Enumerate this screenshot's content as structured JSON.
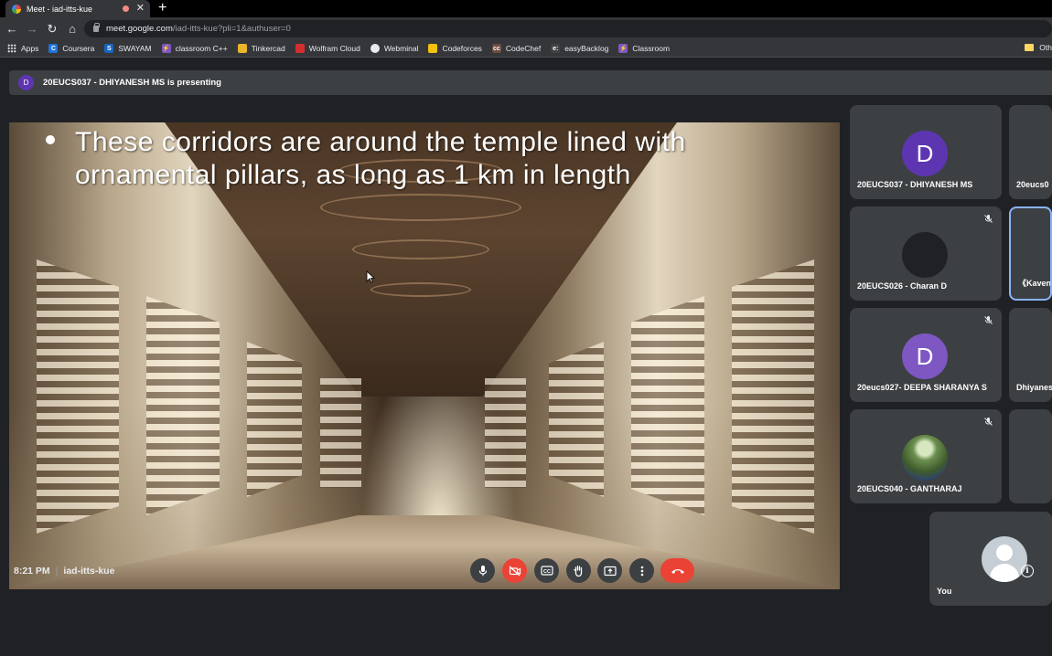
{
  "browser": {
    "tab": {
      "title": "Meet - iad-itts-kue",
      "close": "✕"
    },
    "new_tab": "+",
    "address": {
      "host": "meet.google.com",
      "path": "/iad-itts-kue?pli=1&authuser=0"
    },
    "nav": {
      "back": "←",
      "forward": "→",
      "reload": "↻",
      "home": "⌂"
    },
    "bookmarks": [
      {
        "label": "Apps",
        "icon": "apps-grid-icon",
        "glyph": "",
        "color": "#e8eaed"
      },
      {
        "label": "Coursera",
        "icon": "coursera-icon",
        "glyph": "C",
        "color": "#1f74d9"
      },
      {
        "label": "SWAYAM",
        "icon": "swayam-icon",
        "glyph": "S",
        "color": "#1565c0"
      },
      {
        "label": "classroom C++",
        "icon": "bolt-icon",
        "glyph": "⚡",
        "color": "#7e57c2"
      },
      {
        "label": "Tinkercad",
        "icon": "tinkercad-icon",
        "glyph": "",
        "color": "#e8b52b"
      },
      {
        "label": "Wolfram Cloud",
        "icon": "wolfram-icon",
        "glyph": "",
        "color": "#d32f2f"
      },
      {
        "label": "Webminal",
        "icon": "globe-icon",
        "glyph": "",
        "color": "#e8eaed"
      },
      {
        "label": "Codeforces",
        "icon": "codeforces-icon",
        "glyph": "",
        "color": "#f4c20d"
      },
      {
        "label": "CodeChef",
        "icon": "codechef-icon",
        "glyph": "cc",
        "color": "#6d4c41"
      },
      {
        "label": "easyBacklog",
        "icon": "easybacklog-icon",
        "glyph": "e:",
        "color": "#424242"
      },
      {
        "label": "Classroom",
        "icon": "bolt-icon",
        "glyph": "⚡",
        "color": "#7e57c2"
      }
    ],
    "other_bookmarks": "Oth"
  },
  "meet": {
    "presenting": {
      "avatar_letter": "D",
      "text": "20EUCS037 - DHIYANESH MS is presenting"
    },
    "slide": {
      "text": "These corridors are around the temple lined with ornamental pillars, as long as 1 km in length"
    },
    "participants": [
      {
        "name": "20EUCS037 - DHIYANESH MS",
        "letter": "D",
        "avatar_color": "#5e35b1",
        "muted": false
      },
      {
        "name": "20eucs0",
        "letter": "",
        "avatar_color": "",
        "muted": false
      },
      {
        "name": "20EUCS026 - Charan D",
        "letter": "",
        "avatar_color": "#202124",
        "muted": true
      },
      {
        "name": "《Kaven",
        "letter": "",
        "avatar_color": "",
        "muted": false
      },
      {
        "name": "20eucs027- DEEPA SHARANYA S",
        "letter": "D",
        "avatar_color": "#7e57c2",
        "muted": true
      },
      {
        "name": "Dhiyanes",
        "letter": "",
        "avatar_color": "",
        "muted": false
      },
      {
        "name": "20EUCS040 - GANTHARAJ",
        "letter": "",
        "avatar_color": "photo",
        "muted": true
      },
      {
        "name": "",
        "letter": "",
        "avatar_color": "",
        "muted": false
      }
    ],
    "self_tile": {
      "name": "You"
    },
    "footer": {
      "time": "8:21 PM",
      "meeting_code": "iad-itts-kue"
    },
    "controls": [
      {
        "name": "microphone-button",
        "icon": "microphone-icon"
      },
      {
        "name": "camera-off-button",
        "icon": "camera-off-icon"
      },
      {
        "name": "captions-button",
        "icon": "captions-icon"
      },
      {
        "name": "raise-hand-button",
        "icon": "hand-icon"
      },
      {
        "name": "present-screen-button",
        "icon": "present-screen-icon"
      },
      {
        "name": "more-options-button",
        "icon": "more-vert-icon"
      },
      {
        "name": "end-call-button",
        "icon": "phone-hangup-icon"
      }
    ],
    "colors": {
      "accent_red": "#ea4335",
      "selected_border": "#8ab4f8",
      "tile_bg": "#3c4043",
      "page_bg": "#202124"
    }
  }
}
